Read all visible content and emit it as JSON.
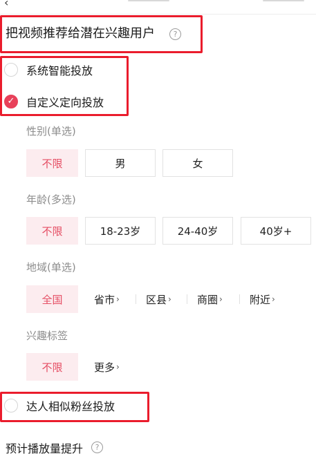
{
  "header": {
    "back_icon": "chevron-left-icon"
  },
  "section": {
    "title": "把视频推荐给潜在兴趣用户",
    "help_icon": "question-circle-icon"
  },
  "delivery_modes": [
    {
      "label": "系统智能投放",
      "checked": false
    },
    {
      "label": "自定义定向投放",
      "checked": true
    },
    {
      "label": "达人相似粉丝投放",
      "checked": false
    }
  ],
  "gender": {
    "label": "性别(单选)",
    "options": [
      "不限",
      "男",
      "女"
    ],
    "selected": "不限"
  },
  "age": {
    "label": "年龄(多选)",
    "options": [
      "不限",
      "18-23岁",
      "24-40岁",
      "40岁+"
    ],
    "selected": "不限"
  },
  "region": {
    "label": "地域(单选)",
    "selected": "全国",
    "options": [
      "省市",
      "区县",
      "商圈",
      "附近"
    ]
  },
  "interest": {
    "label": "兴趣标签",
    "selected": "不限",
    "more": "更多"
  },
  "estimate": {
    "title": "预计播放量提升"
  },
  "colors": {
    "accent": "#e8415a",
    "active_bg": "#fcecef",
    "annotation": "#ea1c2c"
  }
}
